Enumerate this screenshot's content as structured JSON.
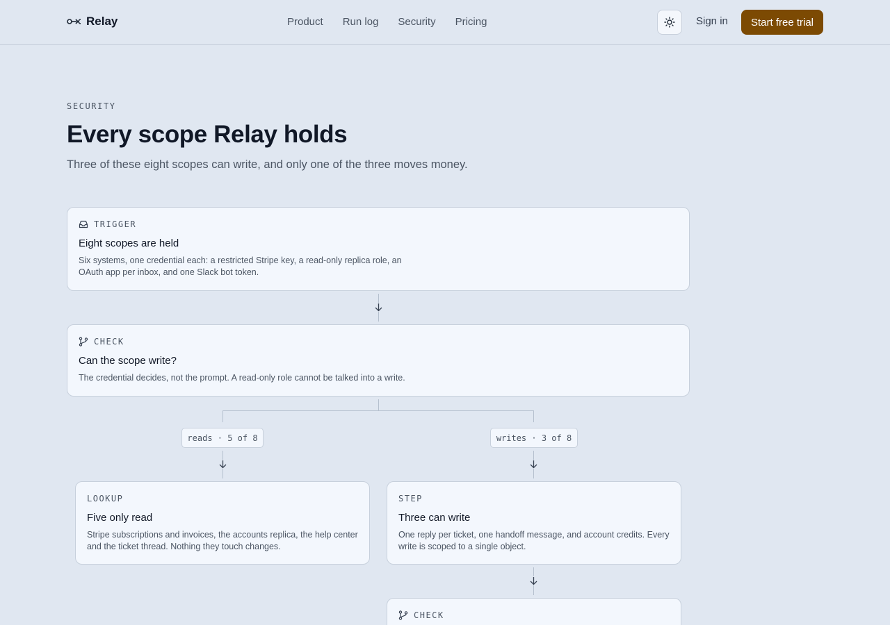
{
  "brand": {
    "name": "Relay"
  },
  "nav": {
    "items": [
      "Product",
      "Run log",
      "Security",
      "Pricing"
    ]
  },
  "header": {
    "signin": "Sign in",
    "cta": "Start free trial"
  },
  "hero": {
    "eyebrow": "SECURITY",
    "title": "Every scope Relay holds",
    "subtitle": "Three of these eight scopes can write, and only one of the three moves money."
  },
  "flow": {
    "trigger": {
      "kind": "TRIGGER",
      "title": "Eight scopes are held",
      "desc": "Six systems, one credential each: a restricted Stripe key, a read-only replica role, an OAuth app per inbox, and one Slack bot token."
    },
    "check": {
      "kind": "CHECK",
      "title": "Can the scope write?",
      "desc": "The credential decides, not the prompt. A read-only role cannot be talked into a write."
    },
    "branches": {
      "reads": "reads · 5 of 8",
      "writes": "writes · 3 of 8"
    },
    "lookup": {
      "kind": "LOOKUP",
      "title": "Five only read",
      "desc": "Stripe subscriptions and invoices, the accounts replica, the help center and the ticket thread. Nothing they touch changes."
    },
    "step": {
      "kind": "STEP",
      "title": "Three can write",
      "desc": "One reply per ticket, one handoff message, and account credits. Every write is scoped to a single object."
    },
    "check2": {
      "kind": "CHECK"
    }
  }
}
